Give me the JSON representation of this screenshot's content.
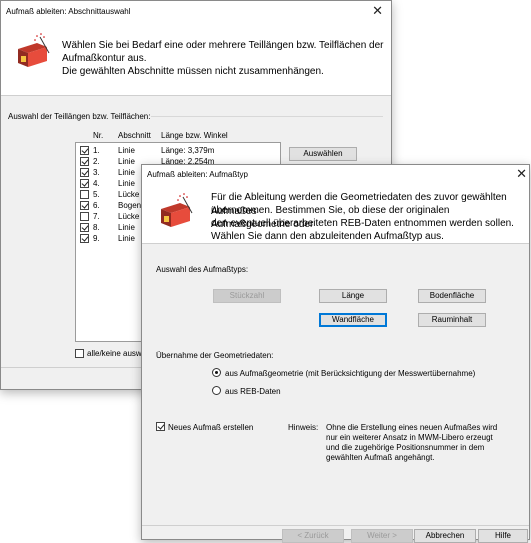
{
  "back_dialog": {
    "title": "Aufmaß ableiten: Abschnittauswahl",
    "header_lines": [
      "Wählen Sie bei Bedarf eine oder mehrere Teillängen bzw. Teilflächen der",
      "Aufmaßkontur aus.",
      "Die gewählten Abschnitte müssen nicht zusammenhängen."
    ],
    "group_label": "Auswahl der Teillängen bzw. Teilflächen:",
    "columns": {
      "nr": "Nr.",
      "abschnitt": "Abschnitt",
      "laenge": "Länge bzw. Winkel"
    },
    "rows": [
      {
        "checked": true,
        "nr": "1.",
        "abschnitt": "Linie",
        "laenge": "Länge: 3,379m"
      },
      {
        "checked": true,
        "nr": "2.",
        "abschnitt": "Linie",
        "laenge": "Länge: 2,254m"
      },
      {
        "checked": true,
        "nr": "3.",
        "abschnitt": "Linie",
        "laenge": ""
      },
      {
        "checked": true,
        "nr": "4.",
        "abschnitt": "Linie",
        "laenge": ""
      },
      {
        "checked": false,
        "nr": "5.",
        "abschnitt": "Lücke",
        "laenge": ""
      },
      {
        "checked": true,
        "nr": "6.",
        "abschnitt": "Bogen",
        "laenge": ""
      },
      {
        "checked": false,
        "nr": "7.",
        "abschnitt": "Lücke",
        "laenge": ""
      },
      {
        "checked": true,
        "nr": "8.",
        "abschnitt": "Linie",
        "laenge": ""
      },
      {
        "checked": true,
        "nr": "9.",
        "abschnitt": "Linie",
        "laenge": ""
      }
    ],
    "select_button": "Auswählen",
    "all_none_label": "alle/keine auswä"
  },
  "front_dialog": {
    "title": "Aufmaß ableiten: Aufmaßtyp",
    "header_lines": [
      "Für die Ableitung werden die Geometriedaten des zuvor gewählten Aufmaßes",
      "übernommen. Bestimmen Sie, ob diese der originalen Aufmaßgeometrie oder",
      "den eventuell überarbeiteten REB-Daten entnommen werden sollen.",
      "Wählen Sie dann den abzuleitenden Aufmaßtyp aus."
    ],
    "type_group_label": "Auswahl des Aufmaßtyps:",
    "type_buttons": {
      "stueckzahl": "Stückzahl",
      "laenge": "Länge",
      "bodenflaeche": "Bodenfläche",
      "wandflaeche": "Wandfläche",
      "rauminhalt": "Rauminhalt"
    },
    "geometry_group_label": "Übernahme der Geometriedaten:",
    "radio_aufmass": "aus Aufmaßgeometrie (mit Berücksichtigung der Messwertübernahme)",
    "radio_reb": "aus REB-Daten",
    "new_aufmass_label": "Neues Aufmaß erstellen",
    "hint_label": "Hinweis:",
    "hint_lines": [
      "Ohne die Erstellung eines neuen Aufmaßes wird",
      "nur ein weiterer Ansatz in MWM-Libero erzeugt",
      "und die zugehörige Positionsnummer in dem",
      "gewählten Aufmaß angehängt."
    ],
    "footer_buttons": {
      "back": "< Zurück",
      "next": "Weiter >",
      "cancel": "Abbrechen",
      "help": "Hilfe"
    }
  }
}
